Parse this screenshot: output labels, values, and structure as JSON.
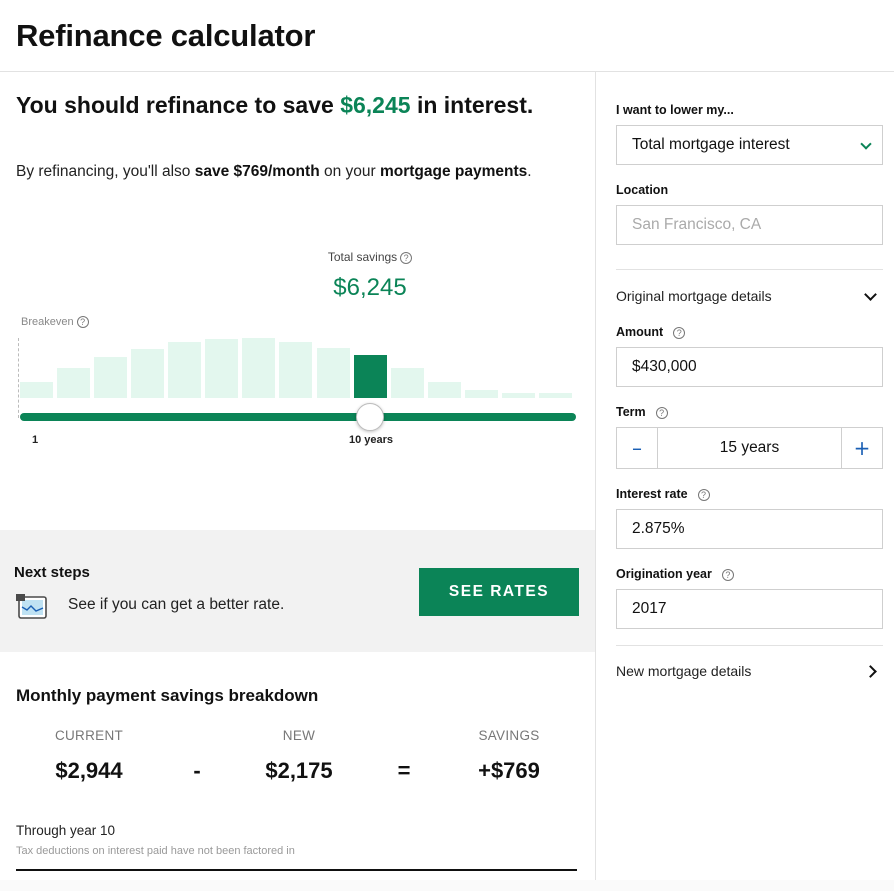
{
  "page": {
    "title": "Refinance calculator"
  },
  "headline": {
    "prefix": "You should refinance to save ",
    "amount": "$6,245",
    "suffix": " in interest."
  },
  "subline": {
    "part1": "By refinancing, you'll also ",
    "bold1": "save $769/month",
    "part2": " on your ",
    "bold2": "mortgage payments",
    "part3": "."
  },
  "savings_chart": {
    "total_label": "Total savings",
    "total_value": "$6,245",
    "breakeven_label": "Breakeven",
    "slider_start_label": "1",
    "slider_current_label": "10 years",
    "slider_position": 0.63,
    "active_bar_index": 9,
    "bar_levels": [
      0.27,
      0.5,
      0.68,
      0.82,
      0.93,
      0.98,
      1.0,
      0.94,
      0.84,
      0.71,
      0.5,
      0.27,
      0.13,
      0.08,
      0.08
    ]
  },
  "next_steps": {
    "title": "Next steps",
    "text": "See if you can get a better rate.",
    "button": "SEE RATES"
  },
  "breakdown": {
    "title": "Monthly payment savings breakdown",
    "current_label": "CURRENT",
    "current_value": "$2,944",
    "minus": "-",
    "new_label": "NEW",
    "new_value": "$2,175",
    "equals": "=",
    "savings_label": "SAVINGS",
    "savings_value": "+$769",
    "through": "Through year 10",
    "footnote": "Tax deductions on interest paid have not been factored in"
  },
  "form": {
    "goal_label": "I want to lower my...",
    "goal_value": "Total mortgage interest",
    "location_label": "Location",
    "location_placeholder": "San Francisco, CA",
    "original_section": "Original mortgage details",
    "amount_label": "Amount",
    "amount_value": "$430,000",
    "term_label": "Term",
    "term_value": "15 years",
    "term_minus": "–",
    "term_plus": "+",
    "rate_label": "Interest rate",
    "rate_value": "2.875%",
    "year_label": "Origination year",
    "year_value": "2017",
    "new_section": "New mortgage details"
  },
  "colors": {
    "accent": "#0b8457",
    "bar_light": "#e3f7ee",
    "panel_bg": "#f2f2f2"
  }
}
